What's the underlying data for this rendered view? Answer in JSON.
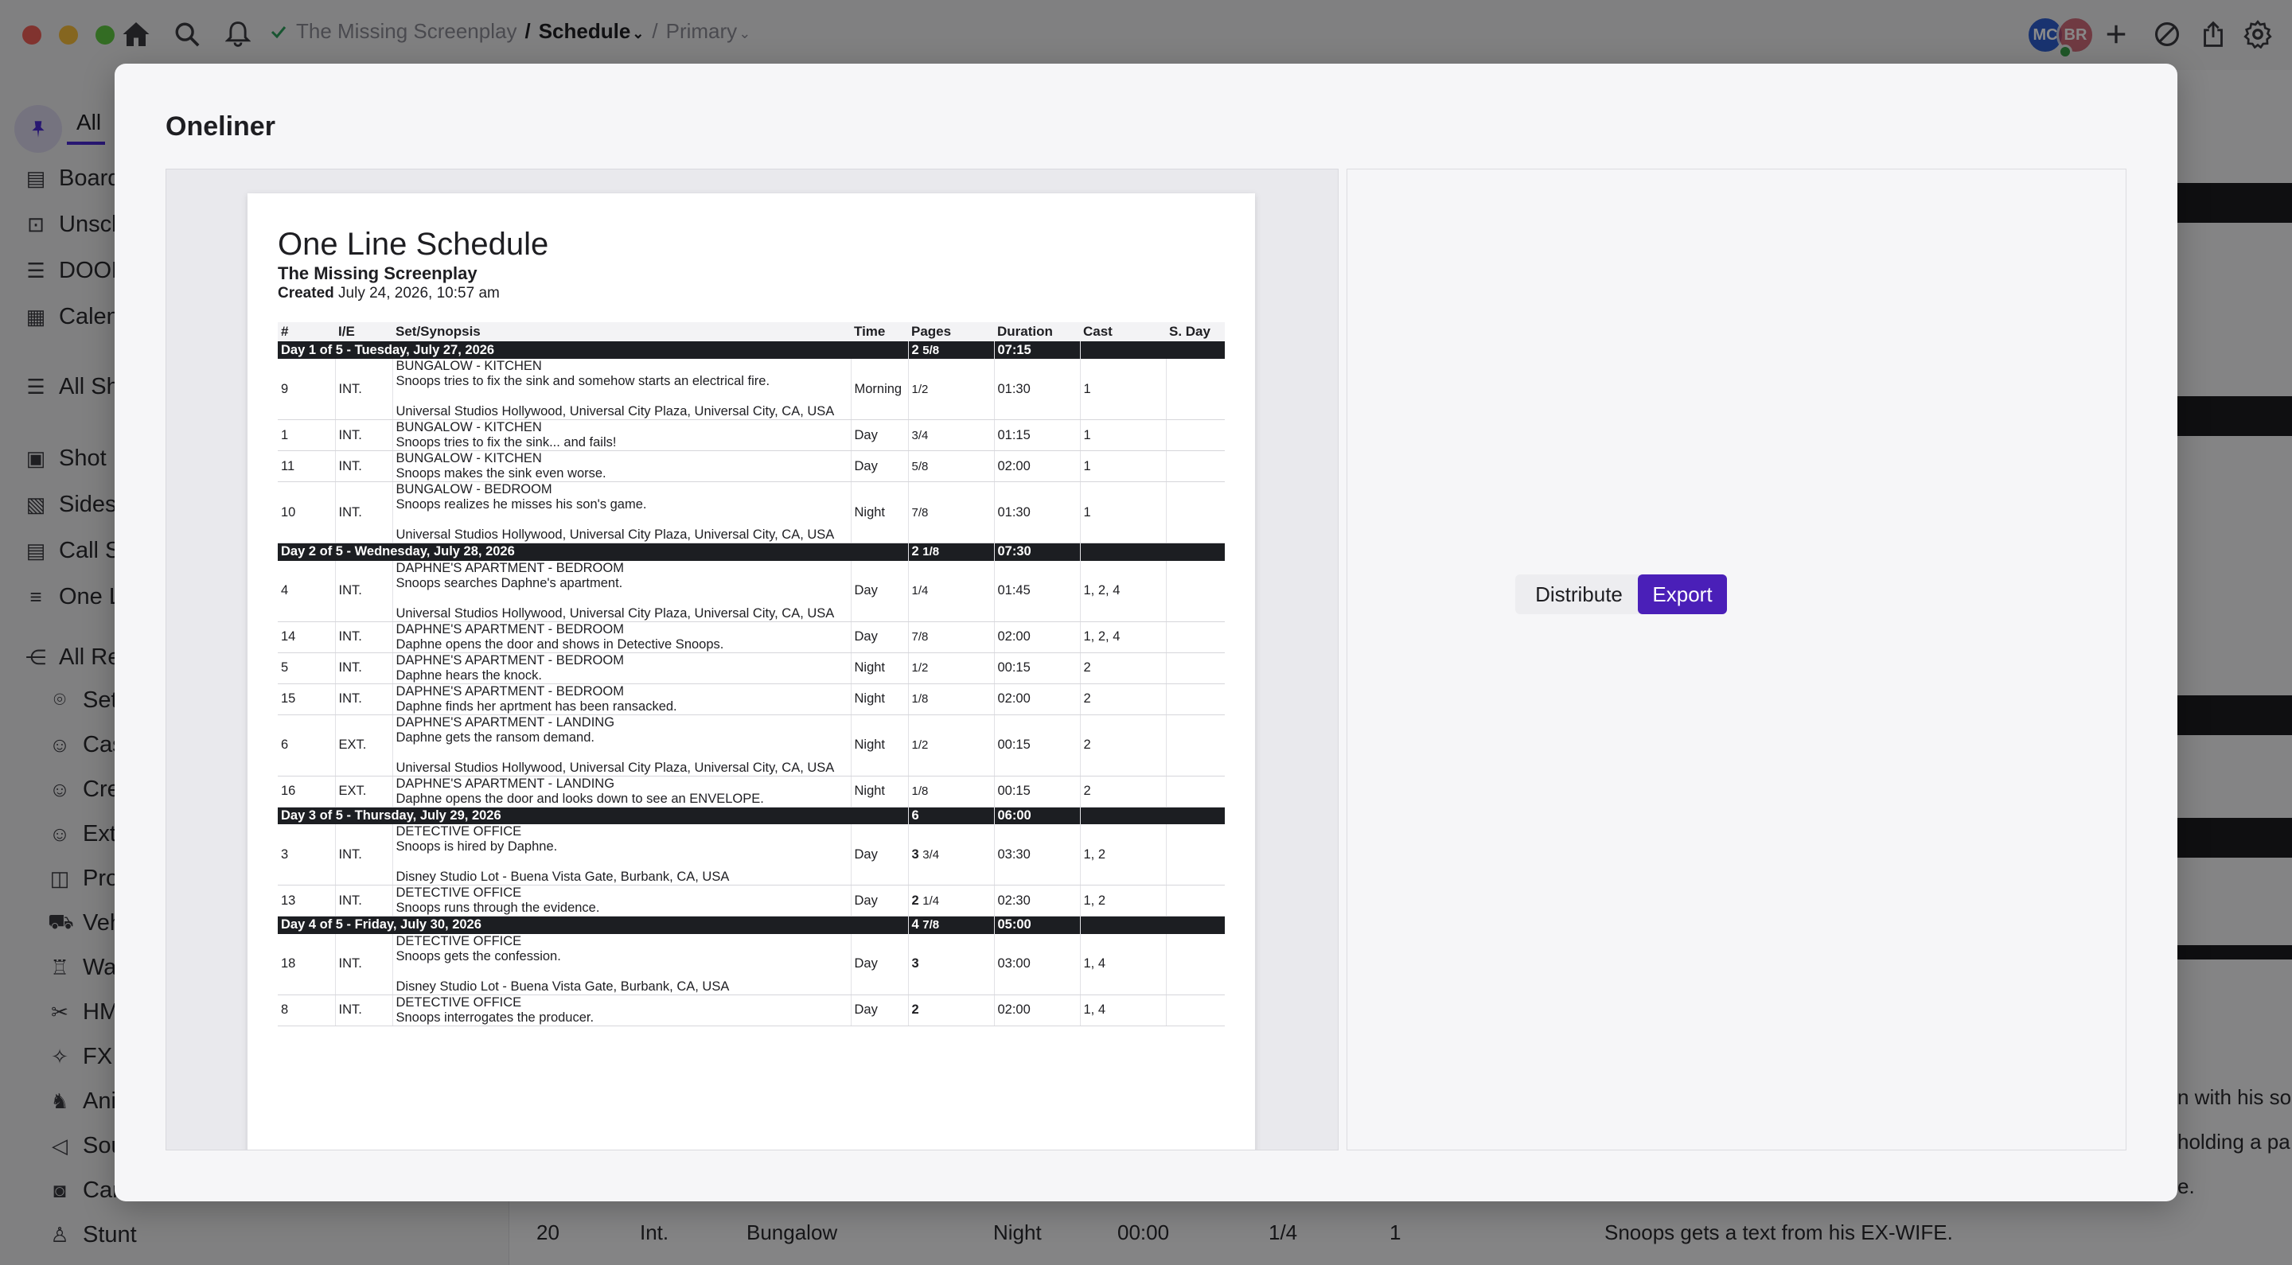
{
  "breadcrumb": {
    "project": "The Missing Screenplay",
    "sep1": "/",
    "schedule": "Schedule",
    "sep2": "/",
    "primary": "Primary"
  },
  "avatars": [
    {
      "initials": "MC",
      "color": "#2f5fcf"
    },
    {
      "initials": "BR",
      "color": "#c94b5e"
    }
  ],
  "sidebar": {
    "tab_all": "All",
    "items": [
      {
        "label": "Board",
        "icon": "board-icon"
      },
      {
        "label": "Unsch",
        "icon": "unscheduled-icon"
      },
      {
        "label": "DOOD",
        "icon": "list-icon"
      },
      {
        "label": "Calend",
        "icon": "calendar-icon"
      },
      {
        "label": "All Sh",
        "icon": "rows-icon"
      },
      {
        "label": "Shot L",
        "icon": "shotlist-icon"
      },
      {
        "label": "Sides",
        "icon": "sides-pdf-icon"
      },
      {
        "label": "Call Sh",
        "icon": "callsheet-icon"
      },
      {
        "label": "One L",
        "icon": "menu-lines-icon"
      },
      {
        "label": "All Res",
        "icon": "share-icon"
      },
      {
        "label": "Set",
        "icon": "location-pin-icon"
      },
      {
        "label": "Cas",
        "icon": "cast-icon"
      },
      {
        "label": "Cre",
        "icon": "crew-icon"
      },
      {
        "label": "Extr",
        "icon": "extras-icon"
      },
      {
        "label": "Pro",
        "icon": "props-box-icon"
      },
      {
        "label": "Veh",
        "icon": "vehicle-icon"
      },
      {
        "label": "War",
        "icon": "wardrobe-shirt-icon"
      },
      {
        "label": "HM",
        "icon": "scissors-icon"
      },
      {
        "label": "FX",
        "icon": "sparkle-icon"
      },
      {
        "label": "Ani",
        "icon": "animal-icon"
      },
      {
        "label": "Sou",
        "icon": "sound-icon"
      },
      {
        "label": "Cam",
        "icon": "camera-icon"
      },
      {
        "label": "Stunt",
        "icon": "stunt-icon"
      }
    ]
  },
  "background": {
    "bottom_row": {
      "num": "20",
      "ie": "Int.",
      "set": "Bungalow",
      "time": "Night",
      "duration": "00:00",
      "pages": "1/4",
      "cast": "1",
      "synopsis": "Snoops gets a text from his EX-WIFE."
    },
    "right_snippets": [
      "n with his so",
      "holding a pa",
      "e."
    ]
  },
  "modal": {
    "title": "Oneliner",
    "distribute_label": "Distribute",
    "export_label": "Export"
  },
  "document": {
    "title": "One Line Schedule",
    "project": "The Missing Screenplay",
    "created_label": "Created",
    "created_value": "July 24, 2026, 10:57 am",
    "headers": [
      "#",
      "I/E",
      "Set/Synopsis",
      "Time",
      "Pages",
      "Duration",
      "Cast",
      "S. Day"
    ],
    "days": [
      {
        "label": "Day 1 of 5 - Tuesday, July 27, 2026",
        "pages_whole": "2",
        "pages_frac": "5/8",
        "duration": "07:15",
        "scenes": [
          {
            "num": "9",
            "ie": "INT.",
            "set": "BUNGALOW - KITCHEN",
            "synopsis": "Snoops tries to fix the sink and somehow starts an electrical fire.",
            "location": "Universal Studios Hollywood, Universal City Plaza, Universal City, CA, USA",
            "time": "Morning",
            "pages_whole": "",
            "pages_frac": "1/2",
            "duration": "01:30",
            "cast": "1"
          },
          {
            "num": "1",
            "ie": "INT.",
            "set": "BUNGALOW - KITCHEN",
            "synopsis": "Snoops tries to fix the sink... and fails!",
            "location": "",
            "time": "Day",
            "pages_whole": "",
            "pages_frac": "3/4",
            "duration": "01:15",
            "cast": "1"
          },
          {
            "num": "11",
            "ie": "INT.",
            "set": "BUNGALOW - KITCHEN",
            "synopsis": "Snoops makes the sink even worse.",
            "location": "",
            "time": "Day",
            "pages_whole": "",
            "pages_frac": "5/8",
            "duration": "02:00",
            "cast": "1"
          },
          {
            "num": "10",
            "ie": "INT.",
            "set": "BUNGALOW - BEDROOM",
            "synopsis": "Snoops realizes he misses his son's game.",
            "location": "Universal Studios Hollywood, Universal City Plaza, Universal City, CA, USA",
            "time": "Night",
            "pages_whole": "",
            "pages_frac": "7/8",
            "duration": "01:30",
            "cast": "1"
          }
        ]
      },
      {
        "label": "Day 2 of 5 - Wednesday, July 28, 2026",
        "pages_whole": "2",
        "pages_frac": "1/8",
        "duration": "07:30",
        "scenes": [
          {
            "num": "4",
            "ie": "INT.",
            "set": "DAPHNE'S APARTMENT - BEDROOM",
            "synopsis": "Snoops searches Daphne's apartment.",
            "location": "Universal Studios Hollywood, Universal City Plaza, Universal City, CA, USA",
            "time": "Day",
            "pages_whole": "",
            "pages_frac": "1/4",
            "duration": "01:45",
            "cast": "1, 2, 4"
          },
          {
            "num": "14",
            "ie": "INT.",
            "set": "DAPHNE'S APARTMENT - BEDROOM",
            "synopsis": "Daphne opens the door and shows in Detective Snoops.",
            "location": "",
            "time": "Day",
            "pages_whole": "",
            "pages_frac": "7/8",
            "duration": "02:00",
            "cast": "1, 2, 4"
          },
          {
            "num": "5",
            "ie": "INT.",
            "set": "DAPHNE'S APARTMENT - BEDROOM",
            "synopsis": "Daphne hears the knock.",
            "location": "",
            "time": "Night",
            "pages_whole": "",
            "pages_frac": "1/2",
            "duration": "00:15",
            "cast": "2"
          },
          {
            "num": "15",
            "ie": "INT.",
            "set": "DAPHNE'S APARTMENT - BEDROOM",
            "synopsis": "Daphne finds her aprtment has been ransacked.",
            "location": "",
            "time": "Night",
            "pages_whole": "",
            "pages_frac": "1/8",
            "duration": "02:00",
            "cast": "2"
          },
          {
            "num": "6",
            "ie": "EXT.",
            "set": "DAPHNE'S APARTMENT - LANDING",
            "synopsis": "Daphne gets the ransom demand.",
            "location": "Universal Studios Hollywood, Universal City Plaza, Universal City, CA, USA",
            "time": "Night",
            "pages_whole": "",
            "pages_frac": "1/2",
            "duration": "00:15",
            "cast": "2"
          },
          {
            "num": "16",
            "ie": "EXT.",
            "set": "DAPHNE'S APARTMENT - LANDING",
            "synopsis": "Daphne opens the door and looks down to see an ENVELOPE.",
            "location": "",
            "time": "Night",
            "pages_whole": "",
            "pages_frac": "1/8",
            "duration": "00:15",
            "cast": "2"
          }
        ]
      },
      {
        "label": "Day 3 of 5 - Thursday, July 29, 2026",
        "pages_whole": "6",
        "pages_frac": "",
        "duration": "06:00",
        "scenes": [
          {
            "num": "3",
            "ie": "INT.",
            "set": "DETECTIVE OFFICE",
            "synopsis": "Snoops is hired by Daphne.",
            "location": "Disney Studio Lot - Buena Vista Gate, Burbank, CA, USA",
            "time": "Day",
            "pages_whole": "3",
            "pages_frac": "3/4",
            "duration": "03:30",
            "cast": "1, 2"
          },
          {
            "num": "13",
            "ie": "INT.",
            "set": "DETECTIVE OFFICE",
            "synopsis": "Snoops runs through the evidence.",
            "location": "",
            "time": "Day",
            "pages_whole": "2",
            "pages_frac": "1/4",
            "duration": "02:30",
            "cast": "1, 2"
          }
        ]
      },
      {
        "label": "Day 4 of 5 - Friday, July 30, 2026",
        "pages_whole": "4",
        "pages_frac": "7/8",
        "duration": "05:00",
        "scenes": [
          {
            "num": "18",
            "ie": "INT.",
            "set": "DETECTIVE OFFICE",
            "synopsis": "Snoops gets the confession.",
            "location": "Disney Studio Lot - Buena Vista Gate, Burbank, CA, USA",
            "time": "Day",
            "pages_whole": "3",
            "pages_frac": "",
            "duration": "03:00",
            "cast": "1, 4"
          },
          {
            "num": "8",
            "ie": "INT.",
            "set": "DETECTIVE OFFICE",
            "synopsis": "Snoops interrogates the producer.",
            "location": "",
            "time": "Day",
            "pages_whole": "2",
            "pages_frac": "",
            "duration": "02:00",
            "cast": "1, 4"
          }
        ]
      }
    ]
  },
  "colors": {
    "accent": "#4a1fb8",
    "day_bar": "#1c1e22",
    "traffic_red": "#ee5f57",
    "traffic_yellow": "#f6bd3b",
    "traffic_green": "#5ec842",
    "check_green": "#2e9e5b"
  }
}
